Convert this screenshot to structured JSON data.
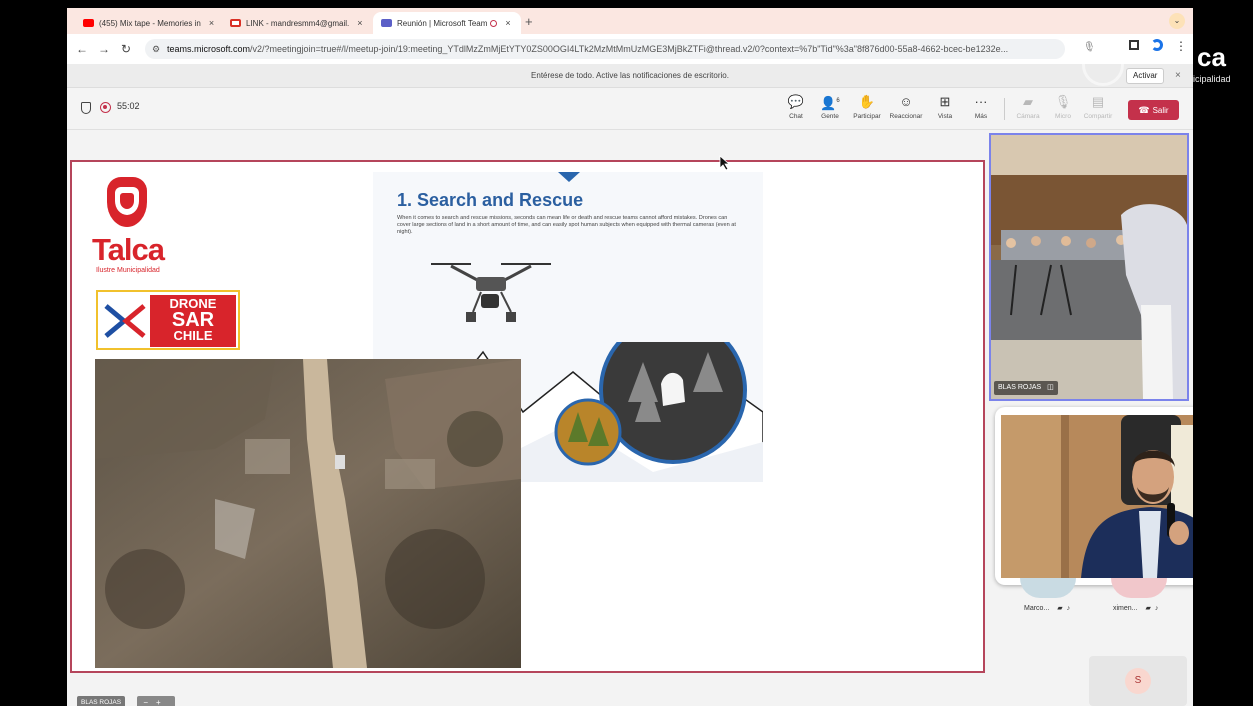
{
  "browser": {
    "tabs": [
      {
        "title": "(455) Mix tape - Memories in",
        "favicon_color": "#ff0000"
      },
      {
        "title": "LINK - mandresmm4@gmail.",
        "favicon_color": "#d93025"
      },
      {
        "title": "Reunión | Microsoft Team",
        "favicon_color": "#5b5fc7",
        "active": true
      }
    ],
    "tab_close": "×",
    "new_tab": "+",
    "url_domain": "teams.microsoft.com",
    "url_rest": "/v2/?meetingjoin=true#/l/meetup-join/19:meeting_YTdlMzZmMjEtYTY0ZS00OGI4LTk2MzMtMmUzMGE3MjBkZTFi@thread.v2/0?context=%7b\"Tid\"%3a\"8f876d00-55a8-4662-bcec-be1232e...",
    "back": "←",
    "forward": "→",
    "reload": "↻"
  },
  "notification": {
    "text": "Entérese de todo. Active las notificaciones de escritorio.",
    "button": "Activar",
    "close": "×"
  },
  "meeting": {
    "timer": "55:02",
    "people_count": "6",
    "buttons": {
      "chat": "Chat",
      "people": "Gente",
      "raise": "Participar",
      "react": "Reaccionar",
      "view": "Vista",
      "more": "Más",
      "camera": "Cámara",
      "mic": "Micro",
      "share": "Compartir",
      "leave": "Salir"
    }
  },
  "slide": {
    "talca": "Talca",
    "talca_sub": "Ilustre Municipalidad",
    "drone_l1": "DRONE",
    "drone_l2": "SAR",
    "drone_l3": "CHILE",
    "sr_title": "1. Search and Rescue",
    "sr_text": "When it comes to search and rescue missions, seconds can mean life or death and rescue teams cannot afford mistakes. Drones can cover large sections of land in a short amount of time, and can easily spot human subjects when equipped with thermal cameras (even at night)."
  },
  "participants": {
    "room_label": "BLAS ROJAS",
    "tile1": "Marco...",
    "tile2": "ximen...",
    "self_initial": "S",
    "bottom_label": "BLAS ROJAS",
    "bottom_ctrl": "−+"
  },
  "overlay": {
    "ca": "ca",
    "mun": "icipalidad"
  },
  "colors": {
    "leave": "#c4314b",
    "accent": "#5b5fc7",
    "slide_border": "#b5455b",
    "talca_red": "#d8242b"
  }
}
